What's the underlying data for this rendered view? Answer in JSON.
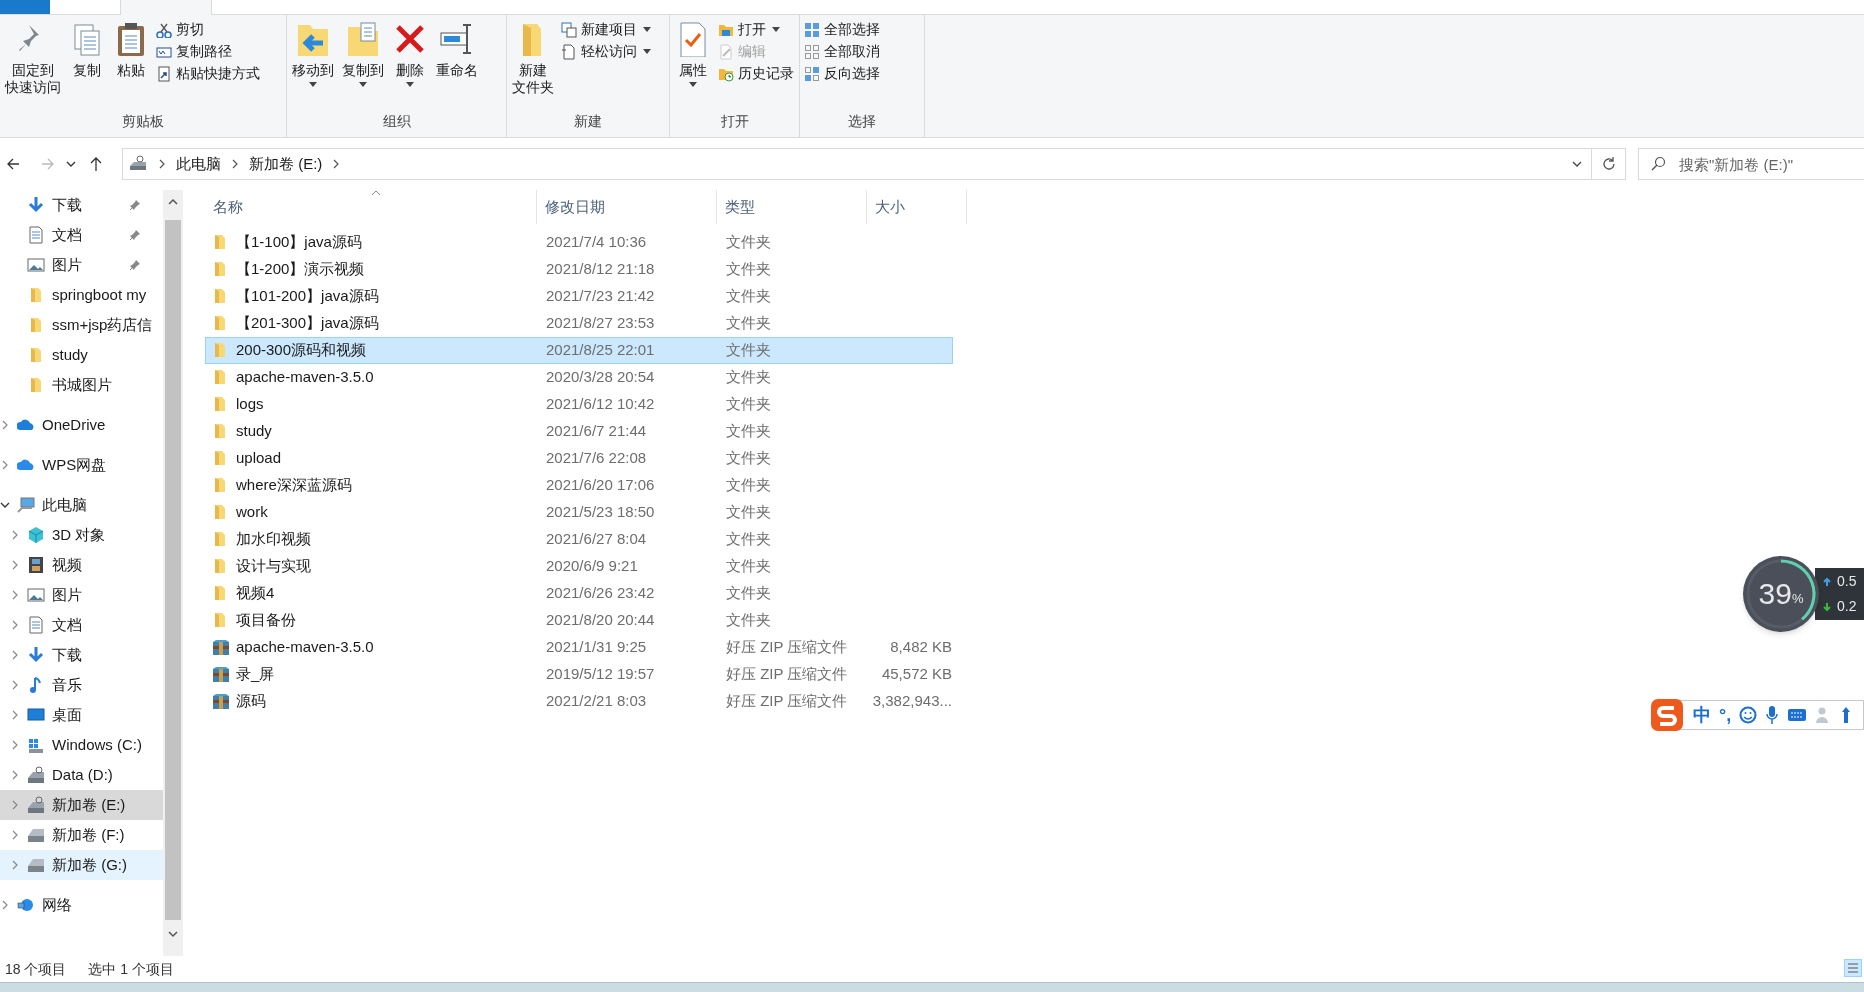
{
  "ribbon": {
    "tabs": [
      {
        "kind": "file",
        "selected": false
      },
      {
        "kind": "tab",
        "selected": true
      }
    ],
    "groups": [
      {
        "label": "剪贴板",
        "large": [
          {
            "lines": [
              "固定到",
              "快速访问"
            ],
            "dropdown": false
          },
          {
            "label": "复制",
            "dropdown": false
          },
          {
            "label": "粘贴",
            "dropdown": false
          }
        ],
        "small": [
          {
            "label": "剪切",
            "dropdown": false,
            "disabled": false
          },
          {
            "label": "复制路径",
            "dropdown": false,
            "disabled": false
          },
          {
            "label": "粘贴快捷方式",
            "dropdown": false,
            "disabled": false
          }
        ]
      },
      {
        "label": "组织",
        "large": [
          {
            "label": "移动到",
            "dropdown": true
          },
          {
            "label": "复制到",
            "dropdown": true
          },
          {
            "label": "删除",
            "dropdown": true
          },
          {
            "label": "重命名",
            "dropdown": false
          }
        ]
      },
      {
        "label": "新建",
        "large": [
          {
            "lines": [
              "新建",
              "文件夹"
            ],
            "dropdown": false
          }
        ],
        "small": [
          {
            "label": "新建项目",
            "dropdown": true,
            "disabled": false
          },
          {
            "label": "轻松访问",
            "dropdown": true,
            "disabled": false
          }
        ]
      },
      {
        "label": "打开",
        "large": [
          {
            "label": "属性",
            "dropdown": true
          }
        ],
        "small": [
          {
            "label": "打开",
            "dropdown": true,
            "disabled": false
          },
          {
            "label": "编辑",
            "dropdown": false,
            "disabled": true
          },
          {
            "label": "历史记录",
            "dropdown": false,
            "disabled": false
          }
        ]
      },
      {
        "label": "选择",
        "small": [
          {
            "label": "全部选择",
            "dropdown": false,
            "disabled": false
          },
          {
            "label": "全部取消",
            "dropdown": false,
            "disabled": false
          },
          {
            "label": "反向选择",
            "dropdown": false,
            "disabled": false
          }
        ]
      }
    ]
  },
  "address": {
    "crumbs": [
      "此电脑",
      "新加卷 (E:)"
    ]
  },
  "search": {
    "placeholder": "搜索\"新加卷 (E:)\""
  },
  "sidebar": {
    "quick_access": [
      {
        "kind": "download",
        "label": "下载",
        "pinned": true,
        "selected": false,
        "hovered": false
      },
      {
        "kind": "document",
        "label": "文档",
        "pinned": true,
        "selected": false,
        "hovered": false
      },
      {
        "kind": "image",
        "label": "图片",
        "pinned": true,
        "selected": false,
        "hovered": false
      },
      {
        "kind": "folder",
        "label": "springboot my",
        "pinned": false,
        "selected": false,
        "hovered": false
      },
      {
        "kind": "folder",
        "label": "ssm+jsp药店信",
        "pinned": false,
        "selected": false,
        "hovered": false
      },
      {
        "kind": "folder",
        "label": "study",
        "pinned": false,
        "selected": false,
        "hovered": false
      },
      {
        "kind": "folder",
        "label": "书城图片",
        "pinned": false,
        "selected": false,
        "hovered": false
      }
    ],
    "tree": [
      {
        "kind": "onedrive",
        "label": "OneDrive",
        "expanded": false,
        "selected": false,
        "hovered": false
      },
      {
        "kind": "cloud",
        "label": "WPS网盘",
        "expanded": false,
        "selected": false,
        "hovered": false
      },
      {
        "kind": "computer",
        "label": "此电脑",
        "expanded": true,
        "selected": false,
        "hovered": false,
        "children": [
          {
            "kind": "cube",
            "label": "3D 对象",
            "expanded": false,
            "selected": false,
            "hovered": false
          },
          {
            "kind": "video",
            "label": "视频",
            "expanded": false,
            "selected": false,
            "hovered": false
          },
          {
            "kind": "image",
            "label": "图片",
            "expanded": false,
            "selected": false,
            "hovered": false
          },
          {
            "kind": "document",
            "label": "文档",
            "expanded": false,
            "selected": false,
            "hovered": false
          },
          {
            "kind": "download",
            "label": "下载",
            "expanded": false,
            "selected": false,
            "hovered": false
          },
          {
            "kind": "music",
            "label": "音乐",
            "expanded": false,
            "selected": false,
            "hovered": false
          },
          {
            "kind": "desktop",
            "label": "桌面",
            "expanded": false,
            "selected": false,
            "hovered": false
          },
          {
            "kind": "windows_drive",
            "label": "Windows (C:)",
            "expanded": false,
            "selected": false,
            "hovered": false
          },
          {
            "kind": "system_drive",
            "label": "Data (D:)",
            "expanded": false,
            "selected": false,
            "hovered": false
          },
          {
            "kind": "system_drive",
            "label": "新加卷 (E:)",
            "expanded": false,
            "selected": true,
            "hovered": false
          },
          {
            "kind": "drive",
            "label": "新加卷 (F:)",
            "expanded": false,
            "selected": false,
            "hovered": false
          },
          {
            "kind": "drive",
            "label": "新加卷 (G:)",
            "expanded": false,
            "selected": false,
            "hovered": true
          }
        ]
      },
      {
        "kind": "network",
        "label": "网络",
        "expanded": false,
        "selected": false,
        "hovered": false
      }
    ]
  },
  "table": {
    "columns": [
      {
        "label": "名称",
        "sorted": true
      },
      {
        "label": "修改日期",
        "sorted": false
      },
      {
        "label": "类型",
        "sorted": false
      },
      {
        "label": "大小",
        "sorted": false
      }
    ],
    "rows": [
      {
        "kind": "folder",
        "name": "【1-100】java源码",
        "date": "2021/7/4 10:36",
        "type": "文件夹",
        "selected": false
      },
      {
        "kind": "folder",
        "name": "【1-200】演示视频",
        "date": "2021/8/12 21:18",
        "type": "文件夹",
        "selected": false
      },
      {
        "kind": "folder",
        "name": "【101-200】java源码",
        "date": "2021/7/23 21:42",
        "type": "文件夹",
        "selected": false
      },
      {
        "kind": "folder",
        "name": "【201-300】java源码",
        "date": "2021/8/27 23:53",
        "type": "文件夹",
        "selected": false
      },
      {
        "kind": "folder",
        "name": "200-300源码和视频",
        "date": "2021/8/25 22:01",
        "type": "文件夹",
        "selected": true
      },
      {
        "kind": "folder",
        "name": "apache-maven-3.5.0",
        "date": "2020/3/28 20:54",
        "type": "文件夹",
        "selected": false
      },
      {
        "kind": "folder",
        "name": "logs",
        "date": "2021/6/12 10:42",
        "type": "文件夹",
        "selected": false
      },
      {
        "kind": "folder",
        "name": "study",
        "date": "2021/6/7 21:44",
        "type": "文件夹",
        "selected": false
      },
      {
        "kind": "folder",
        "name": "upload",
        "date": "2021/7/6 22:08",
        "type": "文件夹",
        "selected": false
      },
      {
        "kind": "folder",
        "name": "where深深蓝源码",
        "date": "2021/6/20 17:06",
        "type": "文件夹",
        "selected": false
      },
      {
        "kind": "folder",
        "name": "work",
        "date": "2021/5/23 18:50",
        "type": "文件夹",
        "selected": false
      },
      {
        "kind": "folder",
        "name": "加水印视频",
        "date": "2021/6/27 8:04",
        "type": "文件夹",
        "selected": false
      },
      {
        "kind": "folder",
        "name": "设计与实现",
        "date": "2020/6/9 9:21",
        "type": "文件夹",
        "selected": false
      },
      {
        "kind": "folder",
        "name": "视频4",
        "date": "2021/6/26 23:42",
        "type": "文件夹",
        "selected": false
      },
      {
        "kind": "folder",
        "name": "项目备份",
        "date": "2021/8/20 20:44",
        "type": "文件夹",
        "selected": false
      },
      {
        "kind": "archive",
        "name": "apache-maven-3.5.0",
        "date": "2021/1/31 9:25",
        "type": "好压 ZIP 压缩文件",
        "size": "8,482 KB",
        "selected": false
      },
      {
        "kind": "archive",
        "name": "录_屏",
        "date": "2019/5/12 19:57",
        "type": "好压 ZIP 压缩文件",
        "size": "45,572 KB",
        "selected": false
      },
      {
        "kind": "archive",
        "name": "源码",
        "date": "2021/2/21 8:03",
        "type": "好压 ZIP 压缩文件",
        "size": "3,382,943...",
        "selected": false
      }
    ]
  },
  "status_bar": {
    "item_count": "18 个项目",
    "selection": "选中 1 个项目"
  },
  "network_monitor": {
    "percent": "39",
    "unit": "%",
    "level": 0.39,
    "upload": "0.5",
    "download": "0.2"
  },
  "ime_toolbar": {
    "mode": "中",
    "punctuation": "°,"
  }
}
